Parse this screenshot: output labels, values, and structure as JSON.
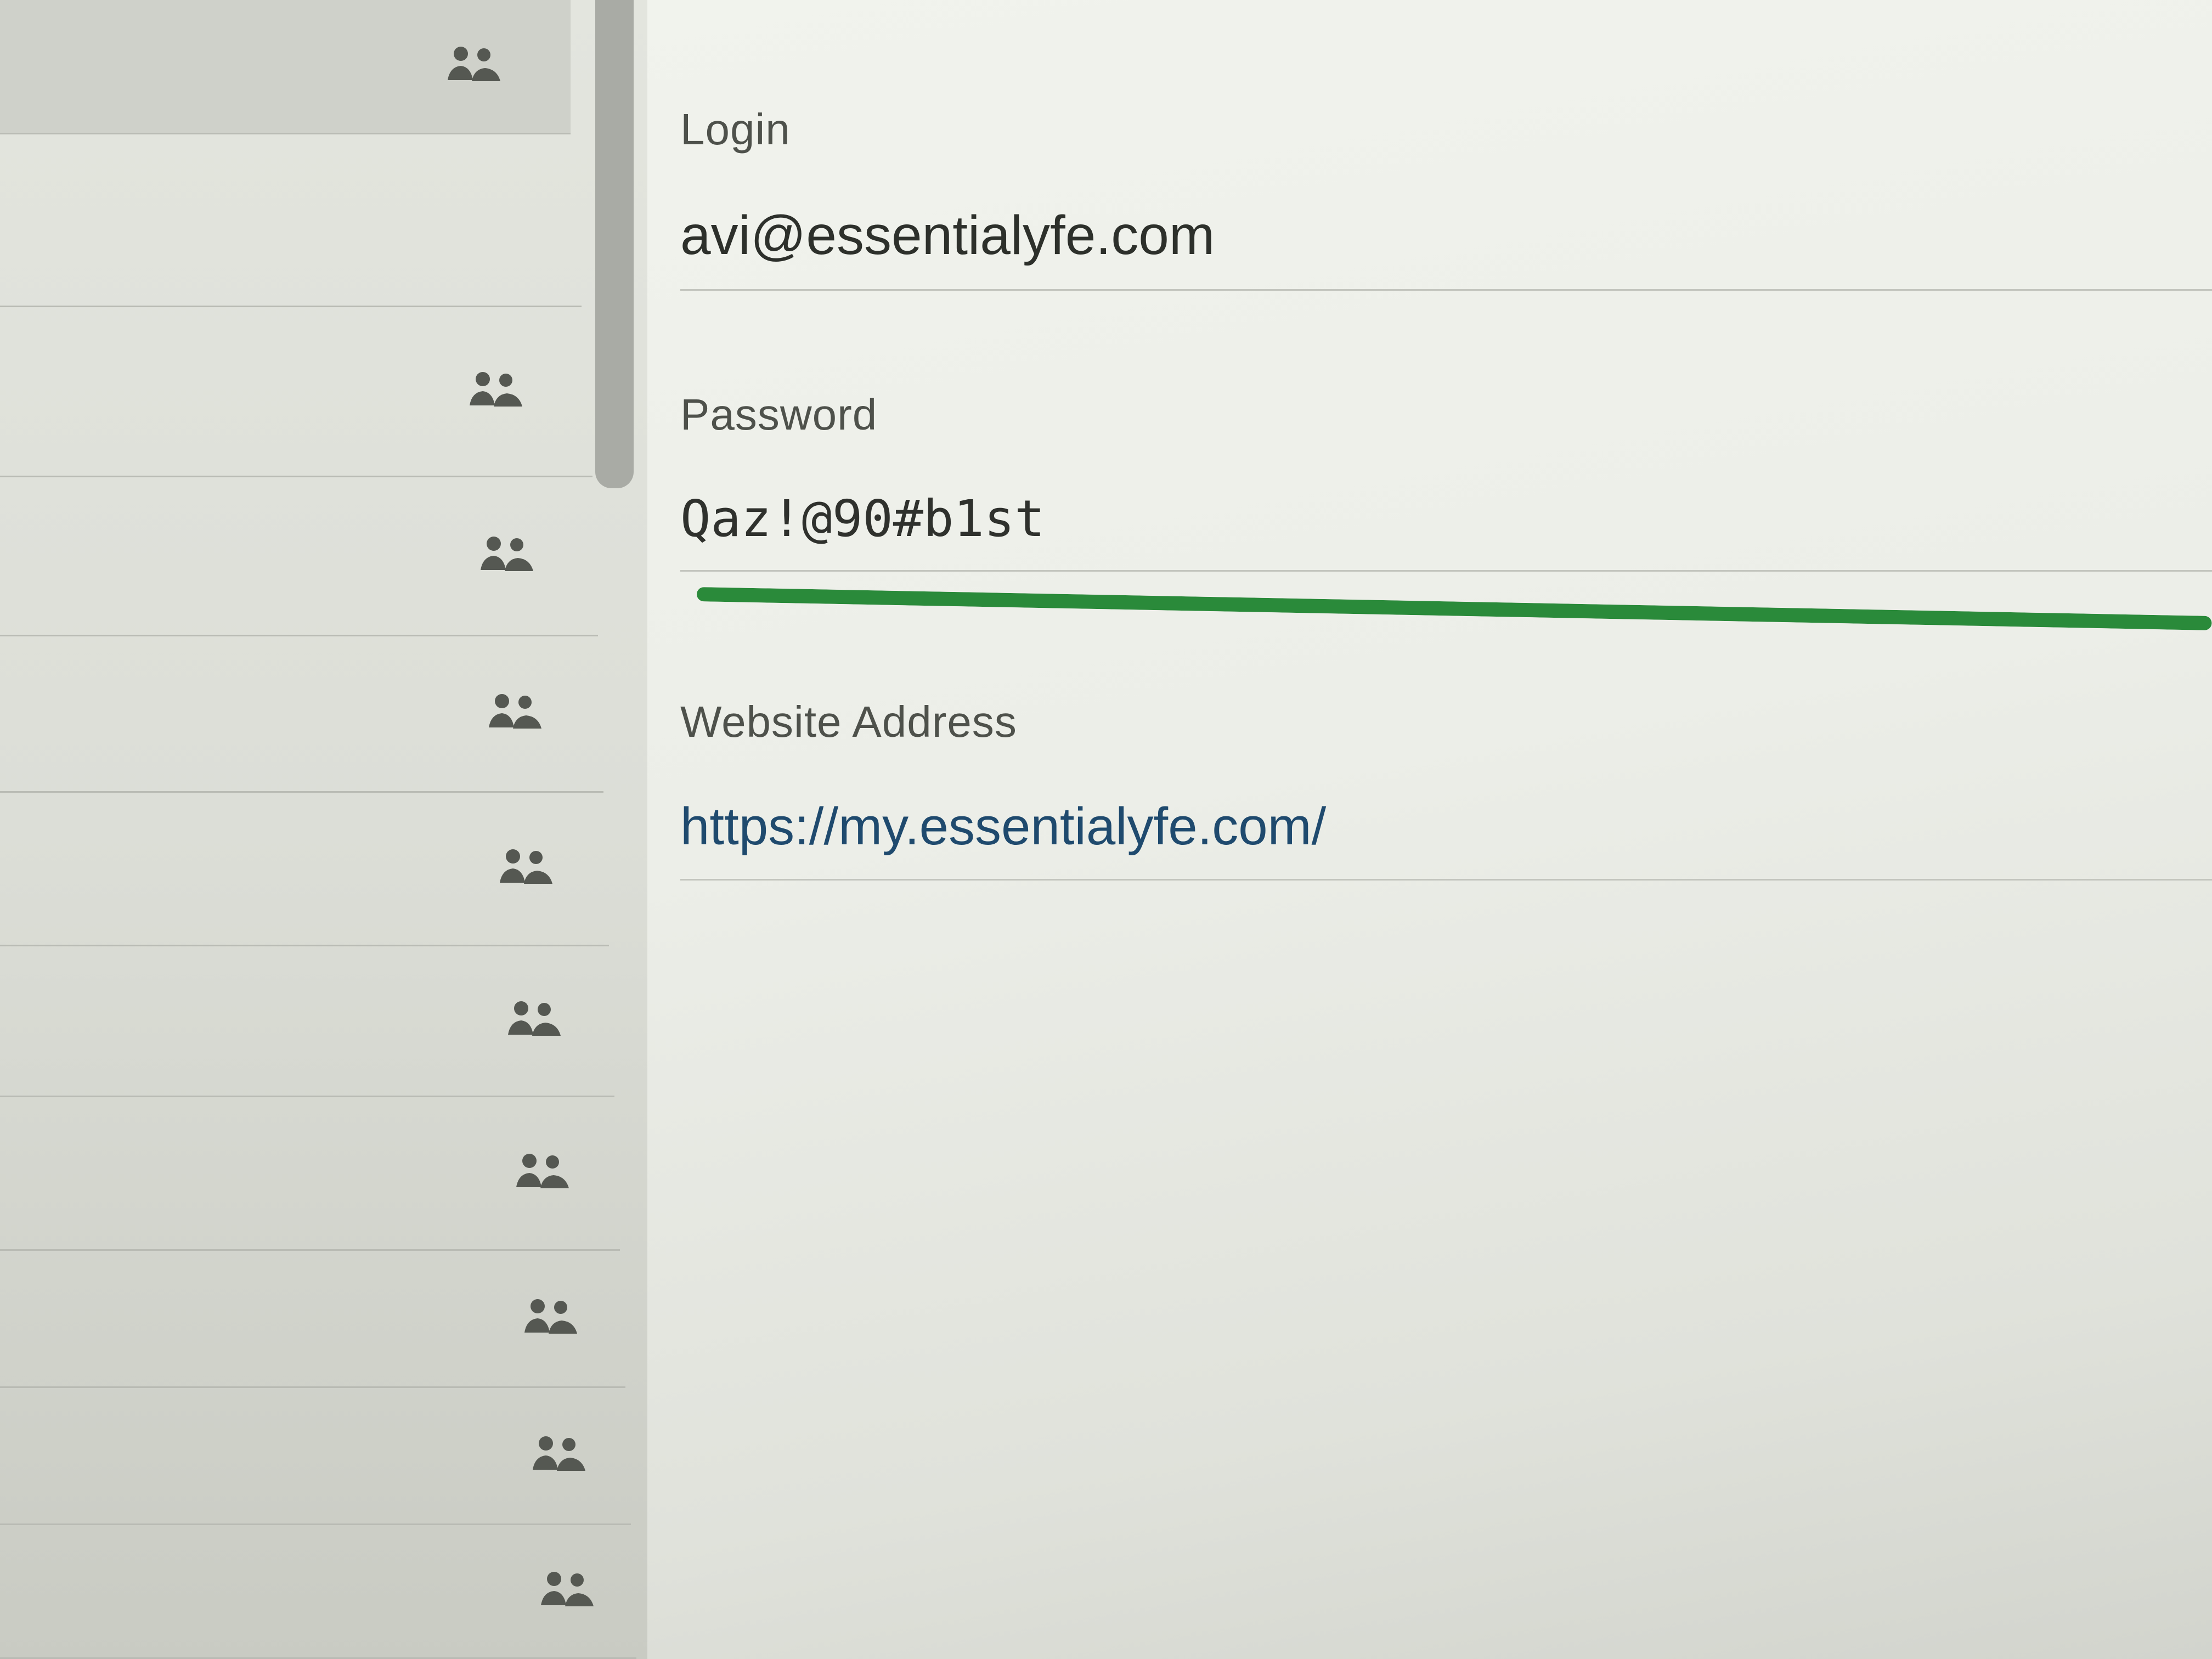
{
  "sidebar": {
    "items": [
      {
        "icon": "users-icon",
        "selected": true
      },
      {
        "icon": "",
        "selected": false
      },
      {
        "icon": "users-icon",
        "selected": false
      },
      {
        "icon": "users-icon",
        "selected": false
      },
      {
        "icon": "users-icon",
        "selected": false
      },
      {
        "icon": "users-icon",
        "selected": false
      },
      {
        "icon": "users-icon",
        "selected": false
      },
      {
        "icon": "users-icon",
        "selected": false
      },
      {
        "icon": "users-icon",
        "selected": false
      },
      {
        "icon": "users-icon",
        "selected": false
      },
      {
        "icon": "users-icon",
        "selected": false
      }
    ]
  },
  "detail": {
    "login": {
      "label": "Login",
      "value": "avi@essentialyfe.com"
    },
    "password": {
      "label": "Password",
      "value": "Qaz!@90#b1st",
      "strength": 1.0,
      "strength_color": "#2a8a3a"
    },
    "website": {
      "label": "Website Address",
      "value": "https://my.essentialyfe.com/"
    }
  }
}
